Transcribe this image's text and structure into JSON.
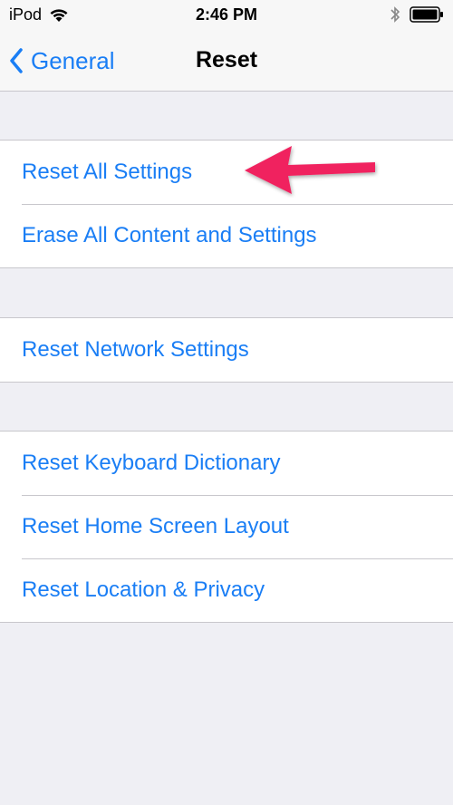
{
  "status_bar": {
    "carrier": "iPod",
    "time": "2:46 PM",
    "icons": [
      "wifi-icon",
      "bluetooth-icon",
      "battery-icon"
    ]
  },
  "nav": {
    "back_label": "General",
    "title": "Reset"
  },
  "groups": [
    {
      "items": [
        "Reset All Settings",
        "Erase All Content and Settings"
      ]
    },
    {
      "items": [
        "Reset Network Settings"
      ]
    },
    {
      "items": [
        "Reset Keyboard Dictionary",
        "Reset Home Screen Layout",
        "Reset Location & Privacy"
      ]
    }
  ],
  "annotation": {
    "icon": "pointer-arrow-icon",
    "color": "#f0245f",
    "target": "Reset All Settings"
  },
  "colors": {
    "accent": "#1a7ef5",
    "background": "#efeff4",
    "separator": "#c8c7cc"
  }
}
